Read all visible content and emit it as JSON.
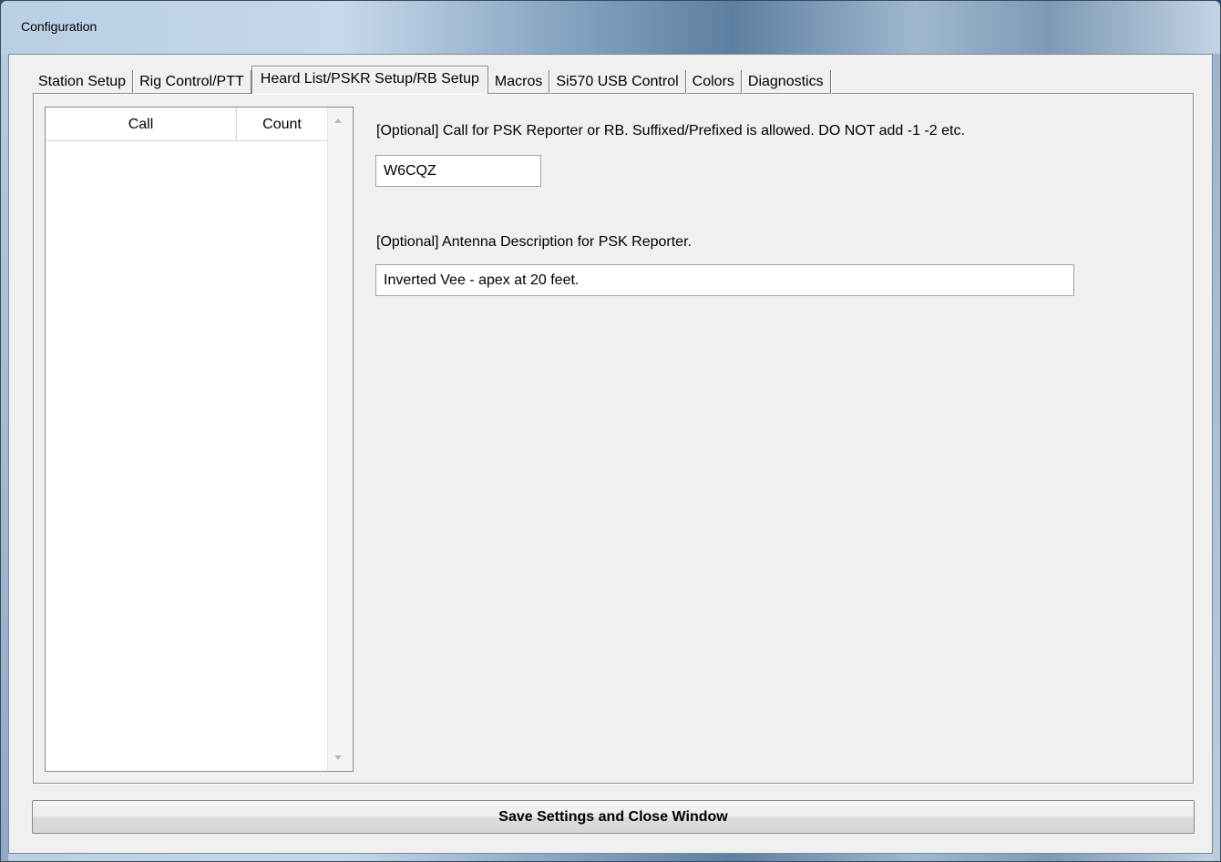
{
  "window": {
    "title": "Configuration"
  },
  "tabs": [
    {
      "label": "Station Setup",
      "active": false
    },
    {
      "label": "Rig Control/PTT",
      "active": false
    },
    {
      "label": "Heard List/PSKR Setup/RB Setup",
      "active": true
    },
    {
      "label": "Macros",
      "active": false
    },
    {
      "label": "Si570 USB Control",
      "active": false
    },
    {
      "label": "Colors",
      "active": false
    },
    {
      "label": "Diagnostics",
      "active": false
    }
  ],
  "heard_list": {
    "columns": [
      "Call",
      "Count"
    ],
    "rows": []
  },
  "psk_reporter": {
    "call_label": "[Optional] Call for PSK Reporter or RB.  Suffixed/Prefixed is allowed.  DO NOT add -1 -2 etc.",
    "call_value": "W6CQZ",
    "antenna_label": "[Optional] Antenna Description for PSK Reporter.",
    "antenna_value": "Inverted Vee - apex at 20 feet."
  },
  "footer": {
    "save_label": "Save Settings and Close Window"
  }
}
